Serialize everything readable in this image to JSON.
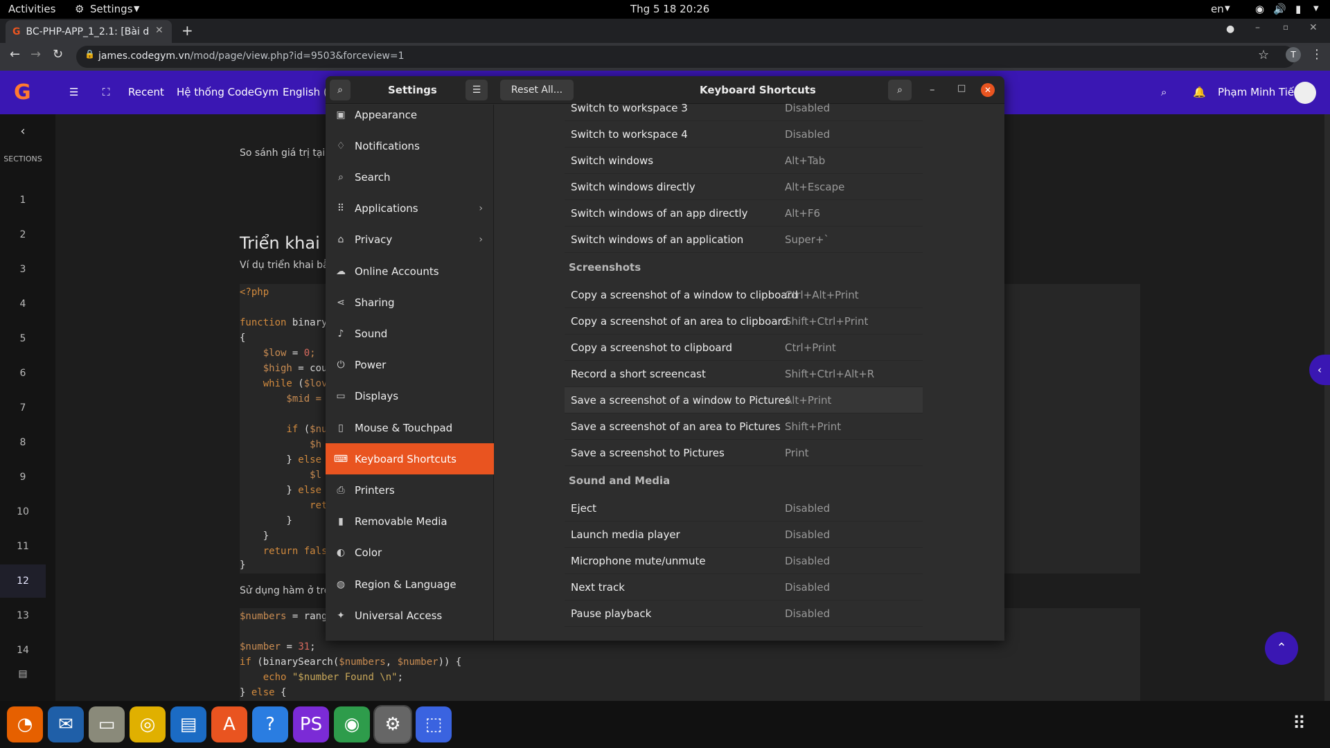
{
  "topbar": {
    "activities": "Activities",
    "app_menu": "Settings",
    "clock": "Thg 5 18  20:26",
    "lang": "en"
  },
  "browser": {
    "tab_title": "BC-PHP-APP_1_2.1: [Bài d",
    "url_host": "james.codegym.vn",
    "url_path": "/mod/page/view.php?id=9503&forceview=1",
    "profile_initial": "T"
  },
  "site": {
    "nav": [
      "Recent",
      "Hệ thống CodeGym",
      "English (e"
    ],
    "user": "Phạm Minh Tiến"
  },
  "course": {
    "sections_label": "SECTIONS",
    "numbers": [
      "1",
      "2",
      "3",
      "4",
      "5",
      "6",
      "7",
      "8",
      "9",
      "10",
      "11",
      "12",
      "13",
      "14"
    ],
    "selected": "12"
  },
  "page": {
    "text1": "So sánh giá trị tại m",
    "heading": "Triển khai t",
    "sub": "Ví dụ triển khai bằn",
    "text2": "Sử dụng hàm ở trê"
  },
  "settings": {
    "title": "Settings",
    "reset": "Reset All...",
    "panel_title": "Keyboard Shortcuts",
    "sidebar": [
      {
        "label": "Appearance",
        "icon": "appearance-icon"
      },
      {
        "label": "Notifications",
        "icon": "bell-icon"
      },
      {
        "label": "Search",
        "icon": "search-icon"
      },
      {
        "label": "Applications",
        "icon": "grid-icon",
        "chevron": true
      },
      {
        "label": "Privacy",
        "icon": "lock-icon",
        "chevron": true
      },
      {
        "label": "Online Accounts",
        "icon": "cloud-icon"
      },
      {
        "label": "Sharing",
        "icon": "share-icon"
      },
      {
        "label": "Sound",
        "icon": "music-note-icon"
      },
      {
        "label": "Power",
        "icon": "power-icon"
      },
      {
        "label": "Displays",
        "icon": "display-icon"
      },
      {
        "label": "Mouse & Touchpad",
        "icon": "mouse-icon"
      },
      {
        "label": "Keyboard Shortcuts",
        "icon": "keyboard-icon",
        "active": true
      },
      {
        "label": "Printers",
        "icon": "printer-icon"
      },
      {
        "label": "Removable Media",
        "icon": "usb-icon"
      },
      {
        "label": "Color",
        "icon": "color-icon"
      },
      {
        "label": "Region & Language",
        "icon": "globe-icon"
      },
      {
        "label": "Universal Access",
        "icon": "accessibility-icon"
      }
    ],
    "shortcuts_top": [
      {
        "name": "Switch to workspace 3",
        "keys": "Disabled"
      },
      {
        "name": "Switch to workspace 4",
        "keys": "Disabled"
      },
      {
        "name": "Switch windows",
        "keys": "Alt+Tab"
      },
      {
        "name": "Switch windows directly",
        "keys": "Alt+Escape"
      },
      {
        "name": "Switch windows of an app directly",
        "keys": "Alt+F6"
      },
      {
        "name": "Switch windows of an application",
        "keys": "Super+`"
      }
    ],
    "screenshots_label": "Screenshots",
    "screenshots": [
      {
        "name": "Copy a screenshot of a window to clipboard",
        "keys": "Ctrl+Alt+Print"
      },
      {
        "name": "Copy a screenshot of an area to clipboard",
        "keys": "Shift+Ctrl+Print"
      },
      {
        "name": "Copy a screenshot to clipboard",
        "keys": "Ctrl+Print"
      },
      {
        "name": "Record a short screencast",
        "keys": "Shift+Ctrl+Alt+R"
      },
      {
        "name": "Save a screenshot of a window to Pictures",
        "keys": "Alt+Print"
      },
      {
        "name": "Save a screenshot of an area to Pictures",
        "keys": "Shift+Print"
      },
      {
        "name": "Save a screenshot to Pictures",
        "keys": "Print"
      }
    ],
    "media_label": "Sound and Media",
    "media": [
      {
        "name": "Eject",
        "keys": "Disabled"
      },
      {
        "name": "Launch media player",
        "keys": "Disabled"
      },
      {
        "name": "Microphone mute/unmute",
        "keys": "Disabled"
      },
      {
        "name": "Next track",
        "keys": "Disabled"
      },
      {
        "name": "Pause playback",
        "keys": "Disabled"
      }
    ]
  },
  "dock": [
    "firefox-icon",
    "thunderbird-icon",
    "files-icon",
    "rhythmbox-icon",
    "writer-icon",
    "software-icon",
    "help-icon",
    "phpstorm-icon",
    "chrome-icon",
    "settings-icon",
    "screenshot-icon"
  ]
}
